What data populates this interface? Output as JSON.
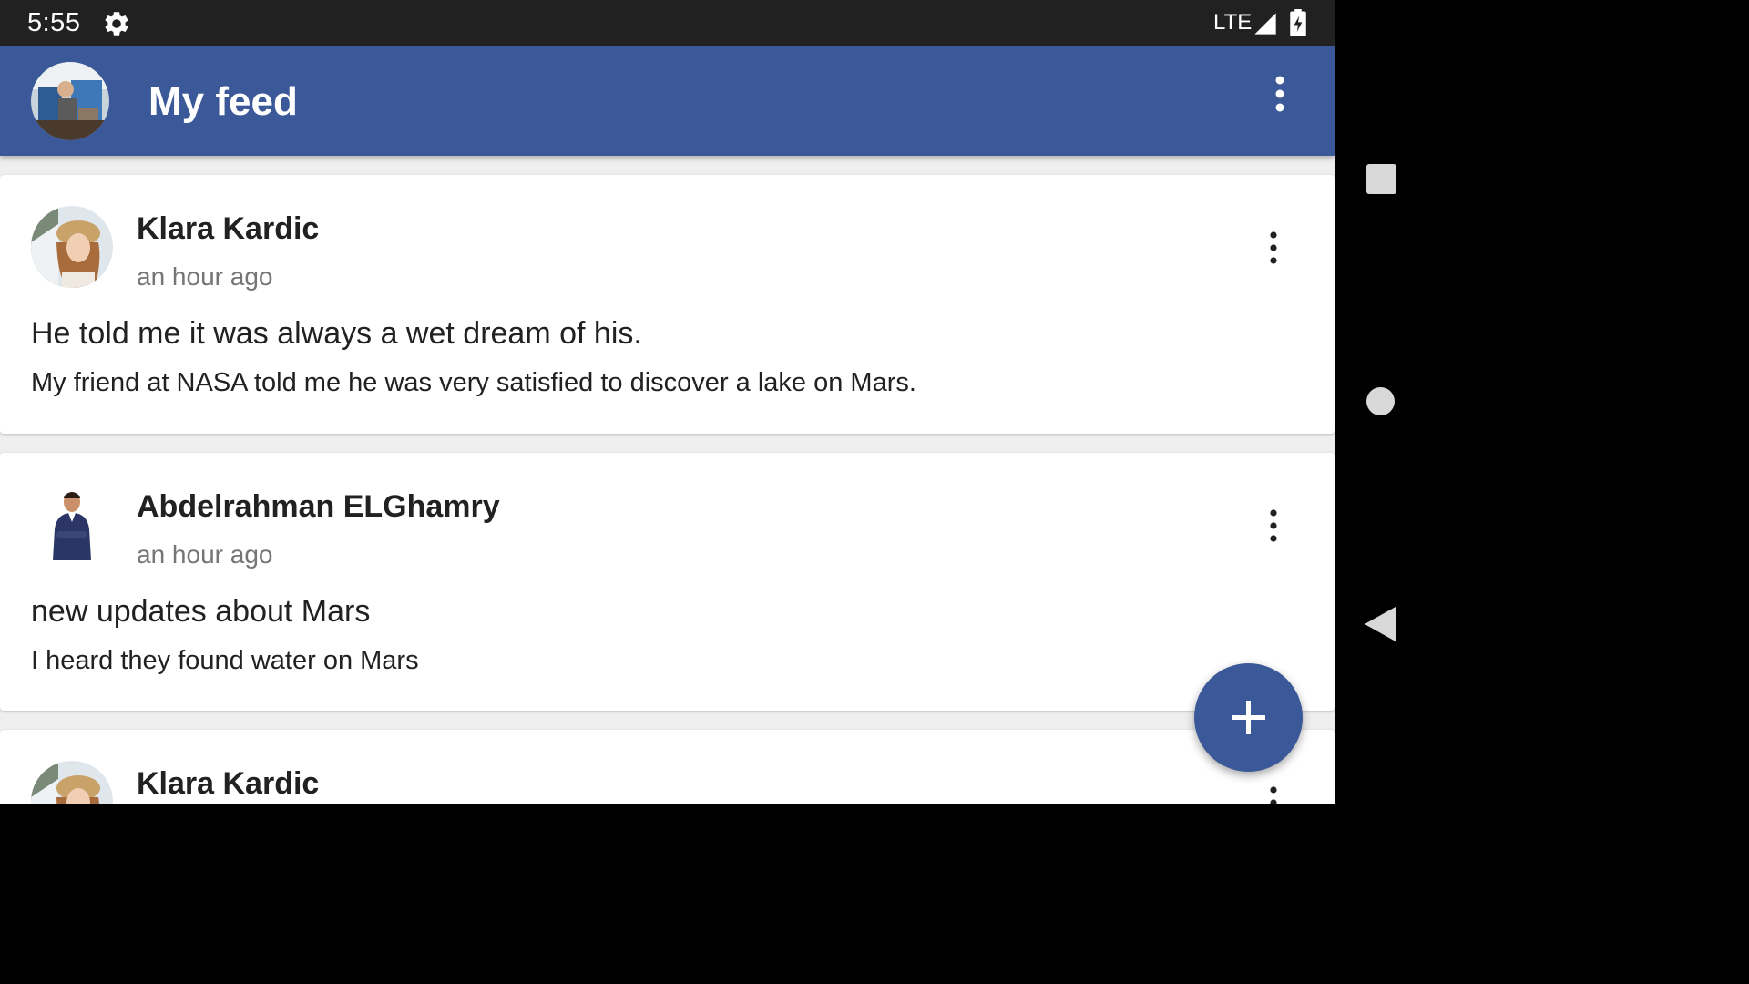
{
  "status_bar": {
    "time": "5:55",
    "network": "LTE",
    "icons": [
      "gear-icon",
      "signal-icon",
      "battery-charging-icon"
    ]
  },
  "app_bar": {
    "title": "My feed",
    "color": "#3b5998",
    "menu_icon": "more-vert-icon"
  },
  "posts": [
    {
      "author": "Klara Kardic",
      "time": "an hour ago",
      "title": "He told me it was always a wet dream of his.",
      "body": "My friend at NASA told me he was very satisfied to discover a lake on Mars."
    },
    {
      "author": "Abdelrahman ELGhamry",
      "time": "an hour ago",
      "title": "new updates about Mars",
      "body": "I heard they found water on Mars"
    },
    {
      "author": "Klara Kardic"
    }
  ],
  "fab": {
    "icon": "plus-icon",
    "color": "#3b5998"
  },
  "nav_bar": {
    "icons": [
      "recent-apps-icon",
      "home-icon",
      "back-icon"
    ]
  }
}
